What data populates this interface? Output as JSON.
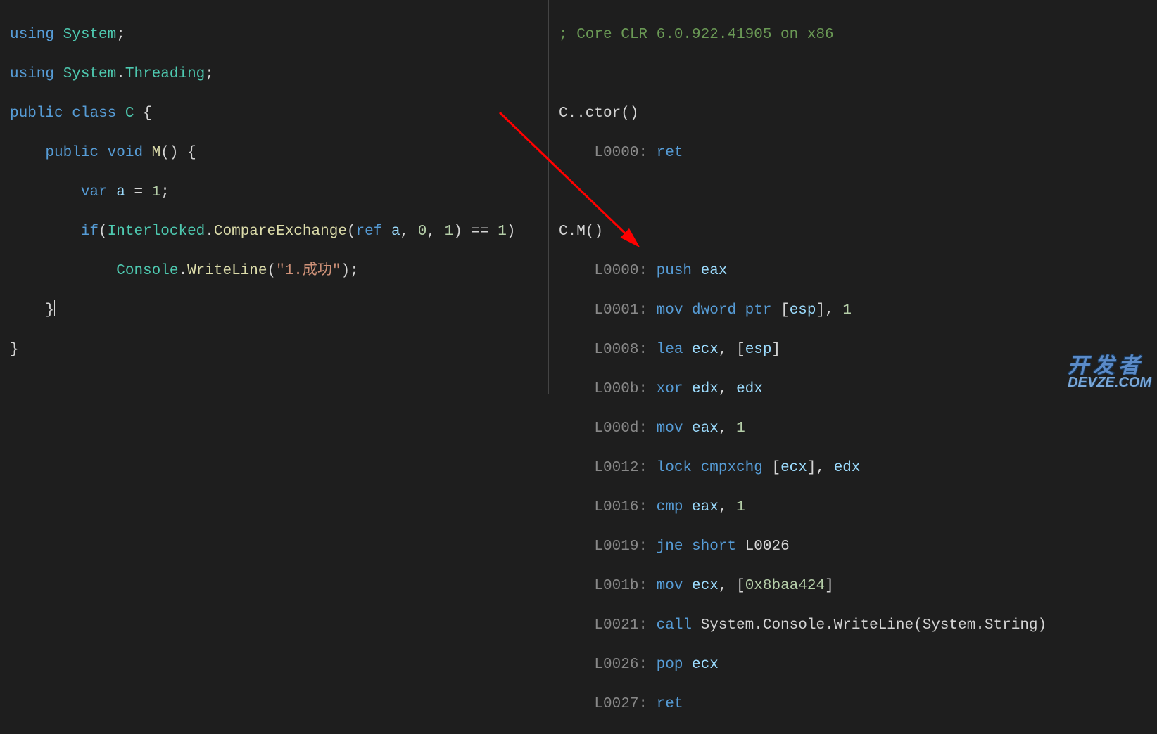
{
  "colors": {
    "background": "#1e1e1e",
    "keyword": "#569cd6",
    "type": "#4ec9b0",
    "method": "#dcdcaa",
    "variable": "#9cdcfe",
    "string": "#ce9178",
    "number": "#b5cea8",
    "comment": "#6a9955",
    "address": "#888888",
    "arrow": "#ff0000"
  },
  "left_code": {
    "line1": {
      "using": "using",
      "ns": "System",
      "semi": ";"
    },
    "line2": {
      "using": "using",
      "ns": "System",
      "dot": ".",
      "sub": "Threading",
      "semi": ";"
    },
    "line3": {
      "public": "public",
      "class": "class",
      "name": "C",
      "brace": " {"
    },
    "line4": {
      "public": "    public",
      "void": "void",
      "name": "M",
      "parens": "()",
      "brace": " {"
    },
    "line5": {
      "indent": "        ",
      "var": "var",
      "name": " a ",
      "eq": "=",
      "val": " 1",
      "semi": ";"
    },
    "line6": {
      "indent": "        ",
      "if": "if",
      "open": "(",
      "class": "Interlocked",
      "dot": ".",
      "method": "CompareExchange",
      "open2": "(",
      "ref": "ref",
      "arg1": " a",
      "c1": ", ",
      "arg2": "0",
      "c2": ", ",
      "arg3": "1",
      "close": ") ",
      "eq": "==",
      "val": " 1",
      "close2": ")"
    },
    "line7": {
      "indent": "            ",
      "class": "Console",
      "dot": ".",
      "method": "WriteLine",
      "open": "(",
      "str": "\"1.成功\"",
      "close": ")",
      "semi": ";"
    },
    "line8": {
      "indent": "    ",
      "brace": "}"
    },
    "line9": {
      "brace": "}"
    }
  },
  "right_code": {
    "header": "; Core CLR 6.0.922.41905 on x86",
    "ctor_sig": "C..ctor()",
    "ctor_l1": {
      "addr": "    L0000: ",
      "op": "ret"
    },
    "m_sig": "C.M()",
    "m_l1": {
      "addr": "    L0000: ",
      "op": "push ",
      "reg": "eax"
    },
    "m_l2": {
      "addr": "    L0001: ",
      "op": "mov ",
      "kw": "dword ptr ",
      "b1": "[",
      "reg": "esp",
      "b2": "], ",
      "num": "1"
    },
    "m_l3": {
      "addr": "    L0008: ",
      "op": "lea ",
      "reg1": "ecx",
      "c": ", ",
      "b1": "[",
      "reg2": "esp",
      "b2": "]"
    },
    "m_l4": {
      "addr": "    L000b: ",
      "op": "xor ",
      "reg1": "edx",
      "c": ", ",
      "reg2": "edx"
    },
    "m_l5": {
      "addr": "    L000d: ",
      "op": "mov ",
      "reg": "eax",
      "c": ", ",
      "num": "1"
    },
    "m_l6": {
      "addr": "    L0012: ",
      "op": "lock cmpxchg ",
      "b1": "[",
      "reg1": "ecx",
      "b2": "], ",
      "reg2": "edx"
    },
    "m_l7": {
      "addr": "    L0016: ",
      "op": "cmp ",
      "reg": "eax",
      "c": ", ",
      "num": "1"
    },
    "m_l8": {
      "addr": "    L0019: ",
      "op": "jne short ",
      "lbl": "L0026"
    },
    "m_l9": {
      "addr": "    L001b: ",
      "op": "mov ",
      "reg": "ecx",
      "c": ", ",
      "b1": "[",
      "addr2": "0x8baa424",
      "b2": "]"
    },
    "m_l10": {
      "addr": "    L0021: ",
      "op": "call ",
      "target": "System.Console.WriteLine(System.String)"
    },
    "m_l11": {
      "addr": "    L0026: ",
      "op": "pop ",
      "reg": "ecx"
    },
    "m_l12": {
      "addr": "    L0027: ",
      "op": "ret"
    }
  },
  "watermark": {
    "line1": "开发者",
    "line2": "DEVZE.COM"
  }
}
